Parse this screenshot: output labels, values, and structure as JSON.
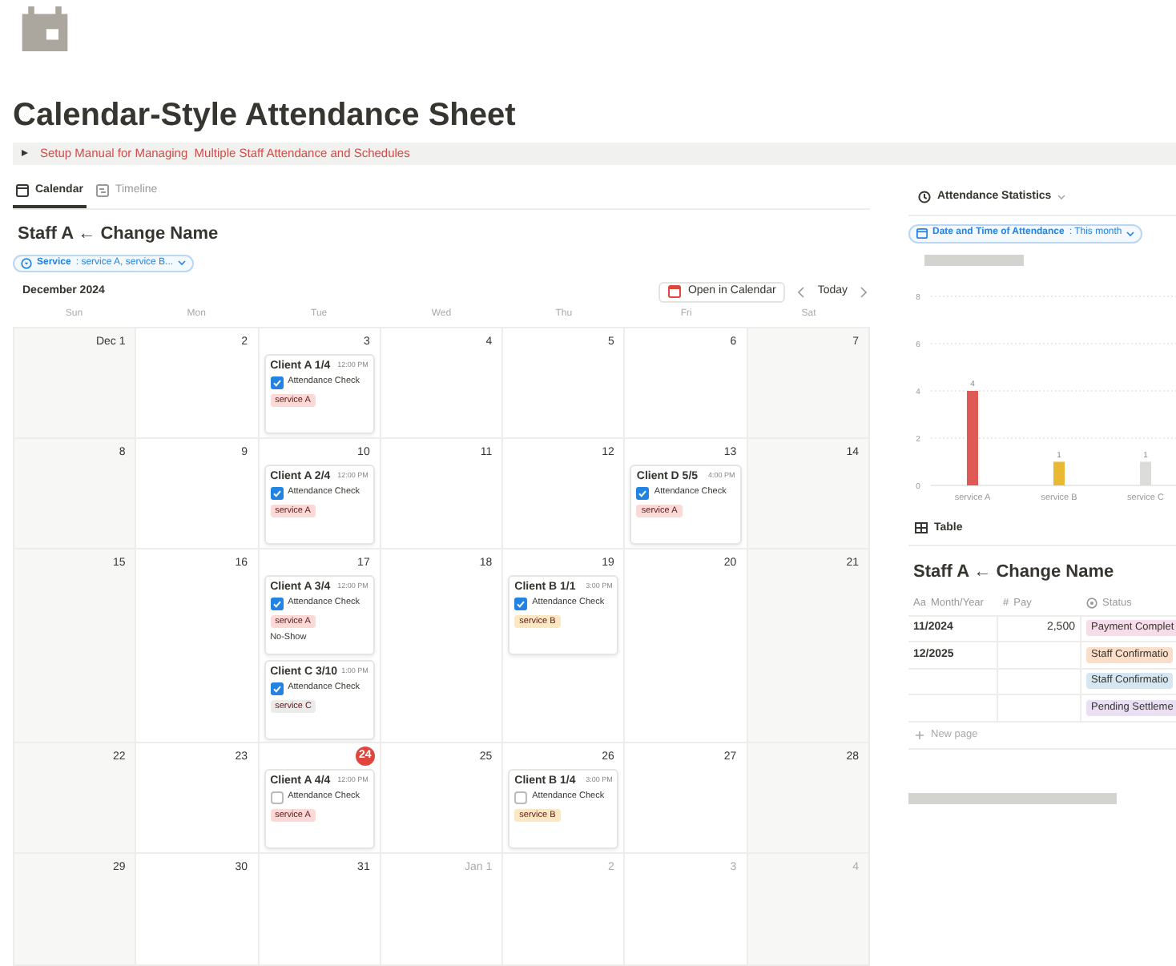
{
  "page": {
    "title": "Calendar-Style Attendance Sheet",
    "toggle": {
      "expanded": false,
      "text": "Setup Manual for Managing  Multiple Staff Attendance and Schedules"
    }
  },
  "tabs": [
    {
      "label": "Calendar",
      "selected": true,
      "kind": "calendar"
    },
    {
      "label": "Timeline",
      "selected": false,
      "kind": "timeline"
    }
  ],
  "calendar": {
    "heading": "Staff A ← Change Name",
    "filter": {
      "label": "Service",
      "value": ": service A, service B..."
    },
    "month": "December 2024",
    "open_button": "Open in Calendar",
    "today_button": "Today",
    "weekdays": [
      "Sun",
      "Mon",
      "Tue",
      "Wed",
      "Thu",
      "Fri",
      "Sat"
    ],
    "weeks": [
      {
        "days": [
          {
            "label": "Dec 1"
          },
          {
            "label": "2"
          },
          {
            "label": "3",
            "events": [
              {
                "title": "Client A 1/4",
                "time": "12:00 PM",
                "check": "Attendance Check",
                "checked": true,
                "tag": {
                  "label": "service A",
                  "color": "#fbd9d6"
                }
              }
            ]
          },
          {
            "label": "4"
          },
          {
            "label": "5"
          },
          {
            "label": "6"
          },
          {
            "label": "7"
          }
        ]
      },
      {
        "days": [
          {
            "label": "8"
          },
          {
            "label": "9"
          },
          {
            "label": "10",
            "events": [
              {
                "title": "Client A 2/4",
                "time": "12:00 PM",
                "check": "Attendance Check",
                "checked": true,
                "tag": {
                  "label": "service A",
                  "color": "#fbd9d6"
                }
              }
            ]
          },
          {
            "label": "11"
          },
          {
            "label": "12"
          },
          {
            "label": "13",
            "events": [
              {
                "title": "Client D 5/5",
                "time": "4:00 PM",
                "check": "Attendance Check",
                "checked": true,
                "tag": {
                  "label": "service A",
                  "color": "#fbd9d6"
                }
              }
            ]
          },
          {
            "label": "14"
          }
        ]
      },
      {
        "days": [
          {
            "label": "15"
          },
          {
            "label": "16"
          },
          {
            "label": "17",
            "events": [
              {
                "title": "Client A 3/4",
                "time": "12:00 PM",
                "check": "Attendance Check",
                "checked": true,
                "tag": {
                  "label": "service A",
                  "color": "#fbd9d6"
                },
                "note": "No-Show"
              },
              {
                "title": "Client C 3/10",
                "time": "1:00 PM",
                "check": "Attendance Check",
                "checked": true,
                "tag": {
                  "label": "service C",
                  "color": "#ebebea"
                }
              }
            ]
          },
          {
            "label": "18"
          },
          {
            "label": "19",
            "events": [
              {
                "title": "Client B 1/1",
                "time": "3:00 PM",
                "check": "Attendance Check",
                "checked": true,
                "tag": {
                  "label": "service B",
                  "color": "#fbe8c3"
                }
              }
            ]
          },
          {
            "label": "20"
          },
          {
            "label": "21"
          }
        ]
      },
      {
        "days": [
          {
            "label": "22"
          },
          {
            "label": "23"
          },
          {
            "label": "24",
            "today": true,
            "events": [
              {
                "title": "Client A 4/4",
                "time": "12:00 PM",
                "check": "Attendance Check",
                "checked": false,
                "tag": {
                  "label": "service A",
                  "color": "#fbd9d6"
                }
              }
            ]
          },
          {
            "label": "25"
          },
          {
            "label": "26",
            "events": [
              {
                "title": "Client B 1/4",
                "time": "3:00 PM",
                "check": "Attendance Check",
                "checked": false,
                "tag": {
                  "label": "service B",
                  "color": "#fbe8c3"
                }
              }
            ]
          },
          {
            "label": "27"
          },
          {
            "label": "28"
          }
        ]
      },
      {
        "days": [
          {
            "label": "29"
          },
          {
            "label": "30"
          },
          {
            "label": "31"
          },
          {
            "label": "Jan 1",
            "muted": true
          },
          {
            "label": "2",
            "muted": true
          },
          {
            "label": "3",
            "muted": true
          },
          {
            "label": "4",
            "muted": true
          }
        ]
      }
    ]
  },
  "statistics": {
    "title": "Attendance Statistics",
    "filter": {
      "label": "Date and Time of Attendance",
      "value": ": This month"
    },
    "chart_data": {
      "type": "bar",
      "categories": [
        "service A",
        "service B",
        "service C"
      ],
      "values": [
        4,
        1,
        1
      ],
      "colors": [
        "#e05a55",
        "#e8b931",
        "#dcdcda"
      ],
      "ylim": [
        0,
        8
      ],
      "yticks": [
        0,
        2,
        4,
        6,
        8
      ],
      "grid": true,
      "data_labels": true
    }
  },
  "table": {
    "view_label": "Table",
    "heading": "Staff A ← Change Name",
    "columns": [
      {
        "label": "Month/Year",
        "kind": "text",
        "icon": "Aa"
      },
      {
        "label": "Pay",
        "kind": "number",
        "icon": "#"
      },
      {
        "label": "Status",
        "kind": "status"
      }
    ],
    "rows": [
      {
        "month": "11/2024",
        "pay": "2,500",
        "status": "Payment Complet",
        "color": "#f7dcea"
      },
      {
        "month": "12/2025",
        "pay": "",
        "status": "Staff Confirmatio",
        "color": "#fadec9"
      },
      {
        "month": "",
        "pay": "",
        "status": "Staff Confirmatio",
        "color": "#d7e7f1"
      },
      {
        "month": "",
        "pay": "",
        "status": "Pending Settleme",
        "color": "#ebdff3"
      }
    ],
    "new_row": "New page"
  }
}
